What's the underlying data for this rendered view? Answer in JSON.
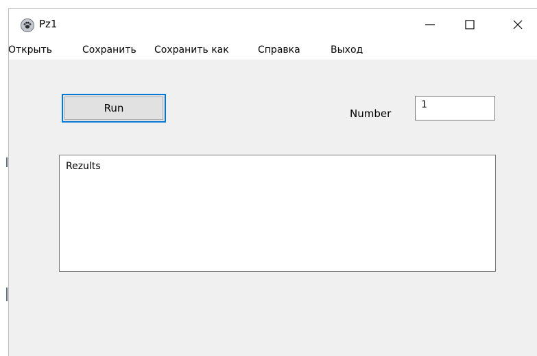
{
  "window": {
    "title": "Pz1",
    "icon": "paw-app-icon",
    "controls": [
      "minimize",
      "maximize",
      "close"
    ]
  },
  "menu": {
    "items": [
      "Открыть",
      "Сохранить",
      "Сохранить как",
      "Справка",
      "Выход"
    ]
  },
  "form": {
    "run_label": "Run",
    "number_label": "Number",
    "number_value": "1",
    "results_text": "Rezults"
  },
  "colors": {
    "window_bg": "#f0f0f0",
    "focus_border": "#0078d7",
    "button_bg": "#e1e1e1"
  }
}
